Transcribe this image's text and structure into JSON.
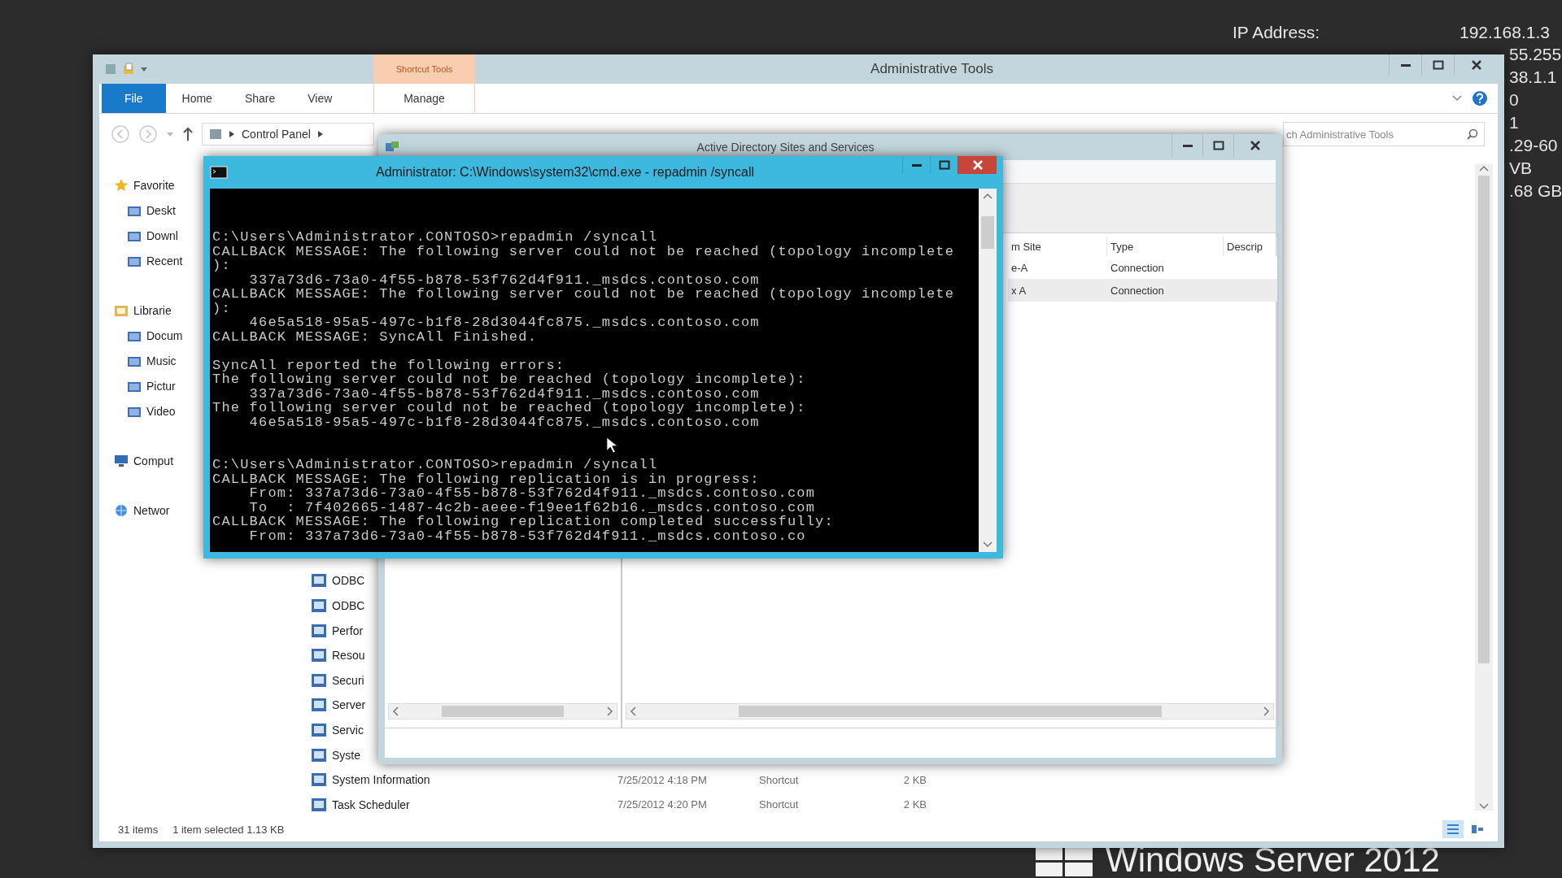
{
  "desktop_info": {
    "label": "IP Address:",
    "value": "192.168.1.3",
    "cut_values": [
      "55.255",
      "38.1.1",
      "0",
      "1",
      ".29-60",
      "VB",
      ".68 GB"
    ]
  },
  "brand": {
    "text": "Windows Server 2012"
  },
  "explorer": {
    "title": "Administrative Tools",
    "contextual_tab": "Shortcut Tools",
    "tabs": [
      {
        "label": "File",
        "selected": true,
        "kind": "standard"
      },
      {
        "label": "Home",
        "selected": false,
        "kind": "standard"
      },
      {
        "label": "Share",
        "selected": false,
        "kind": "standard"
      },
      {
        "label": "View",
        "selected": false,
        "kind": "standard"
      },
      {
        "label": "Manage",
        "selected": false,
        "kind": "contextual"
      }
    ],
    "address": [
      "Control Panel"
    ],
    "search": {
      "placeholder": "ch Administrative Tools"
    },
    "nav": [
      {
        "label": "Favorite",
        "children": [
          {
            "label": "Deskt"
          },
          {
            "label": "Downl"
          },
          {
            "label": "Recent"
          }
        ]
      },
      {
        "label": "Librarie",
        "children": [
          {
            "label": "Docum"
          },
          {
            "label": "Music"
          },
          {
            "label": "Pictur"
          },
          {
            "label": "Video"
          }
        ]
      },
      {
        "label": "Comput"
      },
      {
        "label": "Networ"
      }
    ],
    "files": [
      {
        "name": "ODBC"
      },
      {
        "name": "ODBC"
      },
      {
        "name": "Perfor"
      },
      {
        "name": "Resou"
      },
      {
        "name": "Securi"
      },
      {
        "name": "Server"
      },
      {
        "name": "Servic"
      },
      {
        "name": "Syste"
      },
      {
        "name": "System Information",
        "date": "7/25/2012 4:18 PM",
        "type": "Shortcut",
        "size": "2 KB"
      },
      {
        "name": "Task Scheduler",
        "date": "7/25/2012 4:20 PM",
        "type": "Shortcut",
        "size": "2 KB"
      }
    ],
    "status": {
      "count": "31 items",
      "selection": "1 item selected  1.13 KB"
    }
  },
  "ad_window": {
    "title": "Active Directory Sites and Services",
    "columns": [
      "m Site",
      "Type",
      "Descrip"
    ],
    "rows": [
      {
        "cells": [
          "e-A",
          "Connection"
        ],
        "selected": false
      },
      {
        "cells": [
          "x A",
          "Connection"
        ],
        "selected": true
      }
    ]
  },
  "cmd": {
    "title": "Administrator: C:\\Windows\\system32\\cmd.exe - repadmin  /syncall",
    "blocks": [
      {
        "kind": "command",
        "lines": [
          "C:\\Users\\Administrator.CONTOSO>repadmin /syncall",
          "CALLBACK MESSAGE: The following server could not be reached (topology incomplete",
          "):",
          "    337a73d6-73a0-4f55-b878-53f762d4f911._msdcs.contoso.com",
          "CALLBACK MESSAGE: The following server could not be reached (topology incomplete",
          "):",
          "    46e5a518-95a5-497c-b1f8-28d3044fc875._msdcs.contoso.com",
          "CALLBACK MESSAGE: SyncAll Finished."
        ]
      },
      {
        "kind": "report",
        "lines": [
          "SyncAll reported the following errors:",
          "The following server could not be reached (topology incomplete):",
          "    337a73d6-73a0-4f55-b878-53f762d4f911._msdcs.contoso.com",
          "The following server could not be reached (topology incomplete):",
          "    46e5a518-95a5-497c-b1f8-28d3044fc875._msdcs.contoso.com"
        ]
      },
      {
        "kind": "command",
        "lines": [
          "C:\\Users\\Administrator.CONTOSO>repadmin /syncall",
          "CALLBACK MESSAGE: The following replication is in progress:",
          "    From: 337a73d6-73a0-4f55-b878-53f762d4f911._msdcs.contoso.com",
          "    To  : 7f402665-1487-4c2b-aeee-f19ee1f62b16._msdcs.contoso.com",
          "CALLBACK MESSAGE: The following replication completed successfully:",
          "    From: 337a73d6-73a0-4f55-b878-53f762d4f911._msdcs.contoso.co"
        ]
      }
    ]
  }
}
